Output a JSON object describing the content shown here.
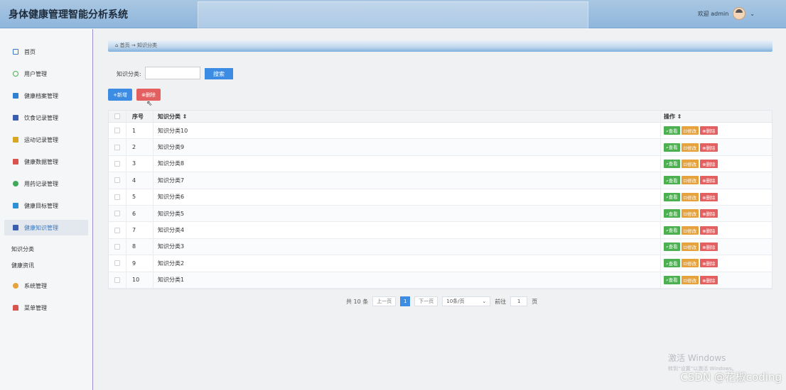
{
  "app": {
    "title": "身体健康管理智能分析系统",
    "welcome": "欢迎 admin",
    "chevron": "⌄"
  },
  "sidebar": {
    "items": [
      {
        "label": "首页",
        "icon": "home-icon",
        "color": "#3a78c2"
      },
      {
        "label": "用户管理",
        "icon": "user-icon",
        "color": "#4caf50"
      },
      {
        "label": "健康档案管理",
        "icon": "folder-icon",
        "color": "#2f7fd3"
      },
      {
        "label": "饮食记录管理",
        "icon": "food-icon",
        "color": "#3a5fb0"
      },
      {
        "label": "运动记录管理",
        "icon": "sport-icon",
        "color": "#d8a525"
      },
      {
        "label": "健康数据管理",
        "icon": "data-icon",
        "color": "#d9534f"
      },
      {
        "label": "用药记录管理",
        "icon": "pill-icon",
        "color": "#3fa95a"
      },
      {
        "label": "健康目标管理",
        "icon": "target-icon",
        "color": "#2d8fd8"
      },
      {
        "label": "健康知识管理",
        "icon": "book-icon",
        "color": "#3a5fb0"
      }
    ],
    "sub_items": [
      "知识分类",
      "健康资讯"
    ],
    "items_after": [
      {
        "label": "系统管理",
        "icon": "gear-icon",
        "color": "#e6a23c"
      },
      {
        "label": "菜单管理",
        "icon": "menu-icon",
        "color": "#d9534f"
      }
    ]
  },
  "breadcrumb": "⌂ 首页 → 知识分类",
  "search": {
    "label": "知识分类:",
    "value": "",
    "placeholder": "",
    "button": "搜索"
  },
  "toolbar": {
    "add": "+新增",
    "delete": "⊗删除"
  },
  "table": {
    "headers": [
      "序号",
      "知识分类 ⇕",
      "操作 ⇕"
    ],
    "rows": [
      {
        "no": "1",
        "name": "知识分类10"
      },
      {
        "no": "2",
        "name": "知识分类9"
      },
      {
        "no": "3",
        "name": "知识分类8"
      },
      {
        "no": "4",
        "name": "知识分类7"
      },
      {
        "no": "5",
        "name": "知识分类6"
      },
      {
        "no": "6",
        "name": "知识分类5"
      },
      {
        "no": "7",
        "name": "知识分类4"
      },
      {
        "no": "8",
        "name": "知识分类3"
      },
      {
        "no": "9",
        "name": "知识分类2"
      },
      {
        "no": "10",
        "name": "知识分类1"
      }
    ],
    "ops": {
      "view": "⌕查看",
      "edit": "⊡修改",
      "delete": "⊗删除"
    }
  },
  "pager": {
    "total": "共 10 条",
    "prev": "上一页",
    "current": "1",
    "next": "下一页",
    "page_size": "10条/页",
    "goto_label": "前往",
    "goto_value": "1",
    "page_suffix": "页"
  },
  "os_notice": {
    "title": "激活 Windows",
    "sub": "转到“设置”以激活 Windows。"
  },
  "watermark": "CSDN @花椒coding"
}
